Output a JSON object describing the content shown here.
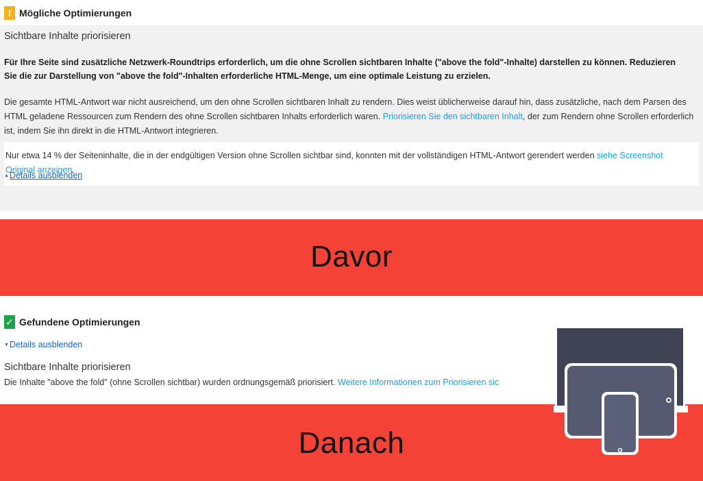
{
  "top": {
    "heading": "Mögliche Optimierungen",
    "warning_glyph": "!",
    "rule_title": "Sichtbare Inhalte priorisieren",
    "bold_paragraph": "Für Ihre Seite sind zusätzliche Netzwerk-Roundtrips erforderlich, um die ohne Scrollen sichtbaren Inhalte (\"above the fold\"-Inhalte) darstellen zu können. Reduzieren Sie die zur Darstellung von \"above the fold\"-Inhalten erforderliche HTML-Menge, um eine optimale Leistung zu erzielen.",
    "body_before": "Die gesamte HTML-Antwort war nicht ausreichend, um den ohne Scrollen sichtbaren Inhalt zu rendern. Dies weist üblicherweise darauf hin, dass zusätzliche, nach dem Parsen des HTML geladene Ressourcen zum Rendern des ohne Scrollen sichtbaren Inhalts erforderlich waren. ",
    "body_link": "Priorisieren Sie den sichtbaren Inhalt",
    "body_after": ", der zum Rendern ohne Scrollen erforderlich ist, indem Sie ihn direkt in die HTML-Antwort integrieren.",
    "card_text": "Nur etwa 14 % der Seiteninhalte, die in der endgültigen Version ohne Scrollen sichtbar sind, konnten mit der vollständigen HTML-Antwort gerendert werden ",
    "card_link": "siehe Screenshot Original anzeigen",
    "card_end": ".",
    "details_toggle": "Details ausblenden"
  },
  "bands": {
    "before_label": "Davor",
    "after_label": "Danach",
    "color": "#f44336"
  },
  "bottom": {
    "heading": "Gefundene Optimierungen",
    "check_glyph": "✓",
    "details_toggle": "Details ausblenden",
    "rule_title": "Sichtbare Inhalte priorisieren",
    "text": "Die Inhalte \"above the fold\" (ohne Scrollen sichtbar) wurden ordnungsgemäß priorisiert. ",
    "link": "Weitere Informationen zum Priorisieren sic"
  },
  "colors": {
    "warning": "#f6b21c",
    "success": "#1fa34a",
    "link": "#1a9fe0"
  },
  "icons": {
    "devices": "responsive-devices-icon"
  }
}
